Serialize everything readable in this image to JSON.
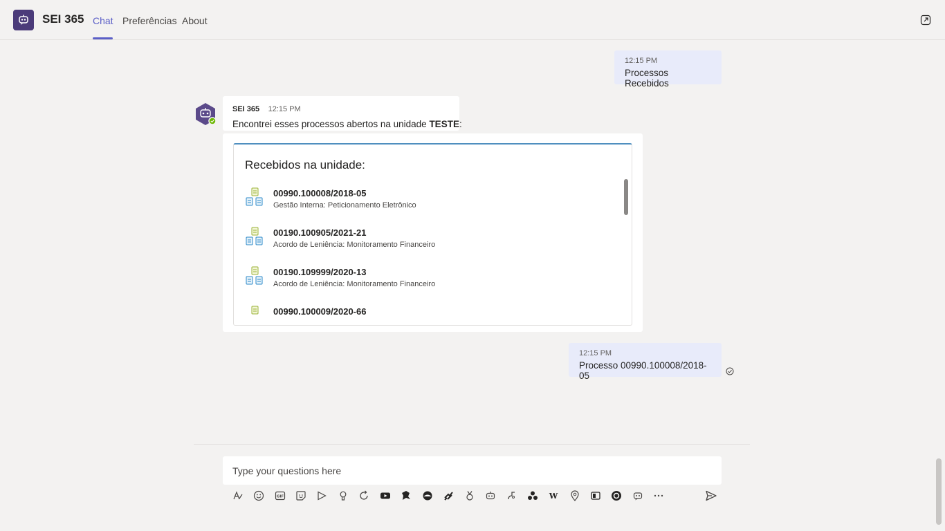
{
  "header": {
    "app_title": "SEI 365",
    "tabs": [
      {
        "label": "Chat",
        "active": true
      },
      {
        "label": "Preferências",
        "active": false
      },
      {
        "label": "About",
        "active": false
      }
    ],
    "accent_color": "#5b5fc7",
    "logo_icon": "bot-chat-icon",
    "right_icon": "popout-icon"
  },
  "messages": {
    "user_1": {
      "time": "12:15 PM",
      "text": "Processos Recebidos"
    },
    "bot": {
      "name": "SEI 365",
      "time": "12:15 PM",
      "text_prefix": "Encontrei esses processos abertos na unidade ",
      "text_bold": "TESTE",
      "text_suffix": ":"
    },
    "card": {
      "title": "Recebidos na unidade:",
      "items": [
        {
          "number": "00990.100008/2018-05",
          "description": "Gestão Interna: Peticionamento Eletrônico"
        },
        {
          "number": "00190.100905/2021-21",
          "description": "Acordo de Leniência: Monitoramento Financeiro"
        },
        {
          "number": "00190.109999/2020-13",
          "description": "Acordo de Leniência: Monitoramento Financeiro"
        },
        {
          "number": "00990.100009/2020-66",
          "description": ""
        }
      ]
    },
    "user_2": {
      "time": "12:15 PM",
      "text": "Processo 00990.100008/2018-05"
    }
  },
  "composer": {
    "placeholder": "Type your questions here",
    "toolbar_icons": [
      "format-icon",
      "emoji-icon",
      "gif-icon",
      "sticker-icon",
      "meet-now-icon",
      "praise-icon",
      "loop-icon",
      "youtube-icon",
      "app-icon",
      "app-icon",
      "app-icon",
      "award-icon",
      "bot-icon",
      "app-icon",
      "app-icon",
      "wikipedia-icon",
      "location-icon",
      "app-icon",
      "app-icon",
      "bot-chat-icon",
      "more-icon"
    ],
    "send_icon": "send-icon"
  }
}
